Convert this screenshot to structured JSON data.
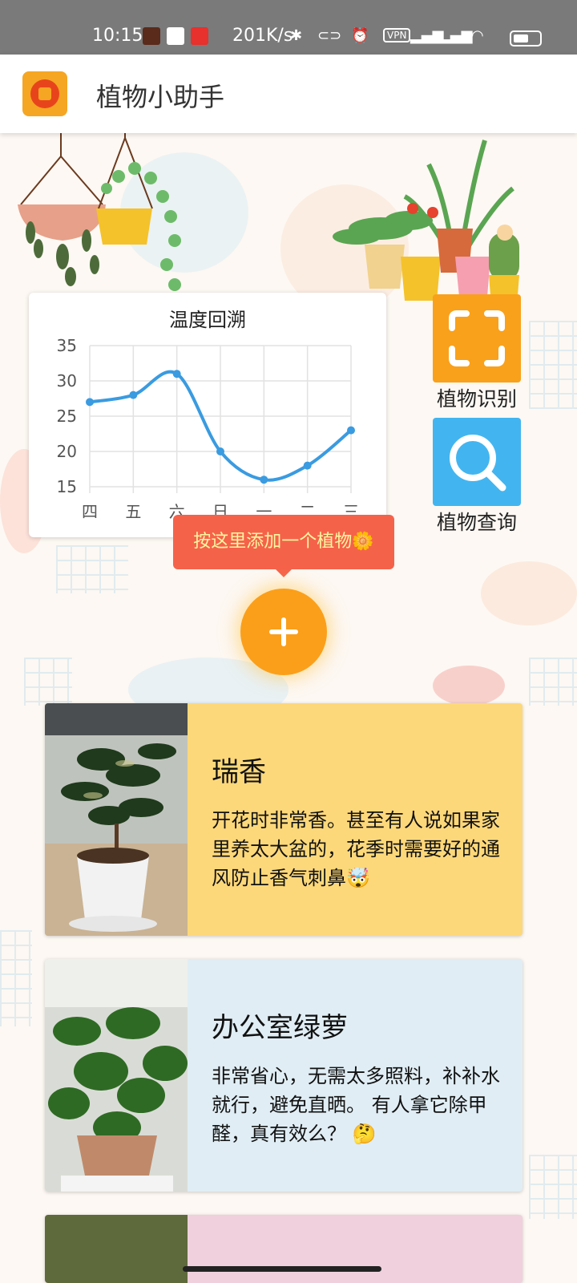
{
  "status_bar": {
    "time": "10:15",
    "speed": "201K/s",
    "vpn": "VPN"
  },
  "app": {
    "title": "植物小助手"
  },
  "chart_card": {
    "chart_data": {
      "type": "line",
      "title": "温度回溯",
      "categories": [
        "四",
        "五",
        "六",
        "日",
        "一",
        "二",
        "三"
      ],
      "values": [
        27,
        28,
        31,
        20,
        16,
        18,
        23
      ],
      "ylim": [
        15,
        35
      ],
      "yticks": [
        15,
        20,
        25,
        30,
        35
      ],
      "grid": true,
      "color": "#3a9be0"
    }
  },
  "actions": {
    "identify_label": "植物识别",
    "search_label": "植物查询",
    "identify_color": "#f9a11b",
    "search_color": "#42b5f0"
  },
  "add_tip": "按这里添加一个植物🌼",
  "plants": [
    {
      "name": "瑞香",
      "desc": "开花时非常香。甚至有人说如果家里养太大盆的，花季时需要好的通风防止香气刺鼻🤯",
      "bg": "#fdd87a"
    },
    {
      "name": "办公室绿萝",
      "desc": "非常省心，无需太多照料，补补水就行，避免直晒。 有人拿它除甲醛，真有效么？ 🤔",
      "bg": "#e0edf4"
    }
  ]
}
